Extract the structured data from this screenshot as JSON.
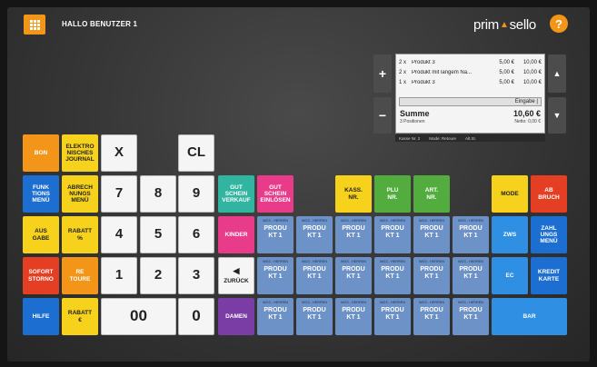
{
  "header": {
    "user_label": "HALLO BENUTZER 1",
    "logo_left": "prim",
    "logo_right": "sello",
    "help_label": "?"
  },
  "receipt": {
    "items": [
      {
        "qty": "2 x",
        "name": "Produkt 3",
        "price": "5,00 €",
        "total": "10,00 €"
      },
      {
        "qty": "2 x",
        "name": "Produkt mit langem Na...",
        "price": "5,00 €",
        "total": "10,00 €"
      },
      {
        "qty": "1 x",
        "name": "Produkt 3",
        "price": "5,00 €",
        "total": "10,00 €"
      }
    ],
    "input_label": "Eingabe |",
    "sum_label": "Summe",
    "sum_value": "10,60 €",
    "positions": "3 Positionen",
    "netto": "Netto: 0,00 €",
    "status": {
      "kasse": "Kasse Nr. 2",
      "mode": "Mode: Retoure",
      "art": "Alt.St."
    }
  },
  "controls": {
    "plus": "+",
    "minus": "−",
    "up": "▲",
    "down": "▼"
  },
  "keys": {
    "bon": "BON",
    "journal": "ELEKTRO\nNISCHES\nJOURNAL",
    "x": "X",
    "cl": "CL",
    "funktionsmenu": "FUNK\nTIONS\nMENÜ",
    "abrechnungsmenu": "ABRECH\nNUNGS\nMENÜ",
    "d7": "7",
    "d8": "8",
    "d9": "9",
    "gutschein_verkauf": "GUT\nSCHEIN\nVERKAUF",
    "gutschein_einloesen": "GUT\nSCHEIN\nEINLÖSEN",
    "kass_nr": "KASS.\nNR.",
    "plu_nr": "PLU\nNR.",
    "art_nr": "ART.\nNR.",
    "mode": "MODE",
    "abbruch": "AB\nBRUCH",
    "ausgabe": "AUS\nGABE",
    "rabatt_pct": "RABATT\n%",
    "d4": "4",
    "d5": "5",
    "d6": "6",
    "kinder": "KINDER",
    "zws": "ZWS",
    "zahlungsmenu": "ZAHL\nUNGS\nMENÜ",
    "sofort_storno": "SOFORT\nSTORNO",
    "retoure": "RE\nTOURE",
    "d1": "1",
    "d2": "2",
    "d3": "3",
    "zurueck": "ZURÜCK",
    "zurueck_icon": "◀",
    "ec": "EC",
    "kreditkarte": "KREDIT\nKARTE",
    "hilfe": "HILFE",
    "rabatt_eur": "RABATT\n€",
    "d00": "00",
    "d0": "0",
    "damen": "DAMEN",
    "bar": "BAR"
  },
  "product_button": {
    "group": "WG3 - HERREN",
    "label": "PRODU\nKT 1"
  },
  "colors": {
    "orange": "#f39519",
    "yellow": "#f6d21c",
    "blue": "#1c6fd1",
    "red": "#e43f22",
    "teal": "#31b5a0",
    "pink": "#e83c8a",
    "green": "#52ad3e",
    "purple": "#7a3da6",
    "light_blue": "#2e8fe3",
    "product_blue": "#6d92c8"
  }
}
